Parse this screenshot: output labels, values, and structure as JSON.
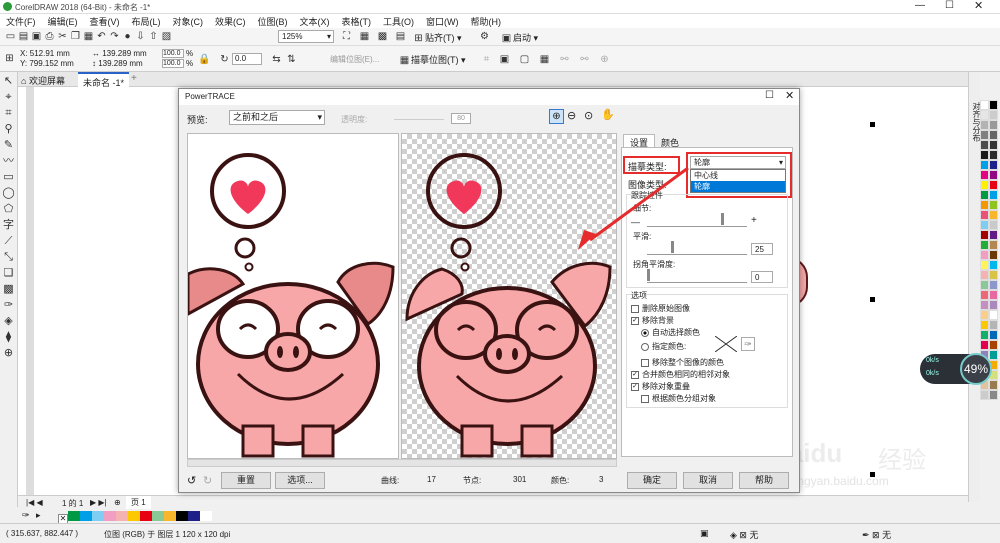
{
  "app": {
    "title": "CorelDRAW 2018 (64-Bit) - 未命名 -1*"
  },
  "menu": [
    "文件(F)",
    "编辑(E)",
    "查看(V)",
    "布局(L)",
    "对象(C)",
    "效果(C)",
    "位图(B)",
    "文本(X)",
    "表格(T)",
    "工具(O)",
    "窗口(W)",
    "帮助(H)"
  ],
  "toolbar": {
    "zoom": "125%",
    "snap_label": "贴齐(T)",
    "launch_label": "启动"
  },
  "propbar": {
    "x": "X: 512.91 mm",
    "y": "Y: 799.152 mm",
    "w": "139.289 mm",
    "h": "139.289 mm",
    "sx": "100.0",
    "sy": "100.0",
    "pct": "%",
    "rotate": "0.0",
    "edit_bitmap": "编辑位图(E)...",
    "trace_bitmap": "描摹位图(T)"
  },
  "doc_tabs": {
    "welcome": "欢迎屏幕",
    "doc": "未命名 -1*"
  },
  "dialog": {
    "title": "PowerTRACE",
    "preview_label": "预览:",
    "preview_mode": "之前和之后",
    "transparency_label": "透明度:",
    "transparency_value": "80",
    "tab_settings": "设置",
    "tab_colors": "颜色",
    "trace_type_label": "描摹类型:",
    "trace_type_value": "轮廓",
    "trace_type_options": [
      "中心线",
      "轮廓"
    ],
    "image_type_label": "图像类型:",
    "trace_controls": "跟踪控件",
    "detail_label": "细节:",
    "smooth_label": "平滑:",
    "smooth_value": "25",
    "corner_label": "拐角平滑度:",
    "corner_value": "0",
    "options_group": "选项",
    "opt_delete_original": "删除原始图像",
    "opt_remove_bg": "移除背景",
    "opt_auto_color": "自动选择颜色",
    "opt_specify_color": "指定颜色:",
    "opt_remove_all_color": "移除整个图像的颜色",
    "opt_merge_adjacent": "合并颜色相同的相邻对象",
    "opt_remove_overlap": "移除对象重叠",
    "opt_group_by_color": "根据颜色分组对象",
    "reset": "重置",
    "options": "选项...",
    "curves_label": "曲线:",
    "curves_value": "17",
    "nodes_label": "节点:",
    "nodes_value": "301",
    "colors_label": "颜色:",
    "colors_value": "3",
    "ok": "确定",
    "cancel": "取消",
    "help": "帮助"
  },
  "pagebar": {
    "page_count": "1 的 1",
    "page_label": "页 1"
  },
  "status": {
    "coords": "( 315.637, 882.447 )",
    "info": "位图 (RGB) 于 图层 1 120 x 120 dpi",
    "fill_none": "无",
    "outline_none": "无"
  },
  "right_panel": {
    "label": "对齐与分布"
  },
  "overlay": {
    "speed1": "0k/s",
    "speed2": "0k/s",
    "percent": "49%"
  },
  "watermark": {
    "brand": "Baidu",
    "cn": "经验",
    "url": "jingyan.baidu.com"
  }
}
